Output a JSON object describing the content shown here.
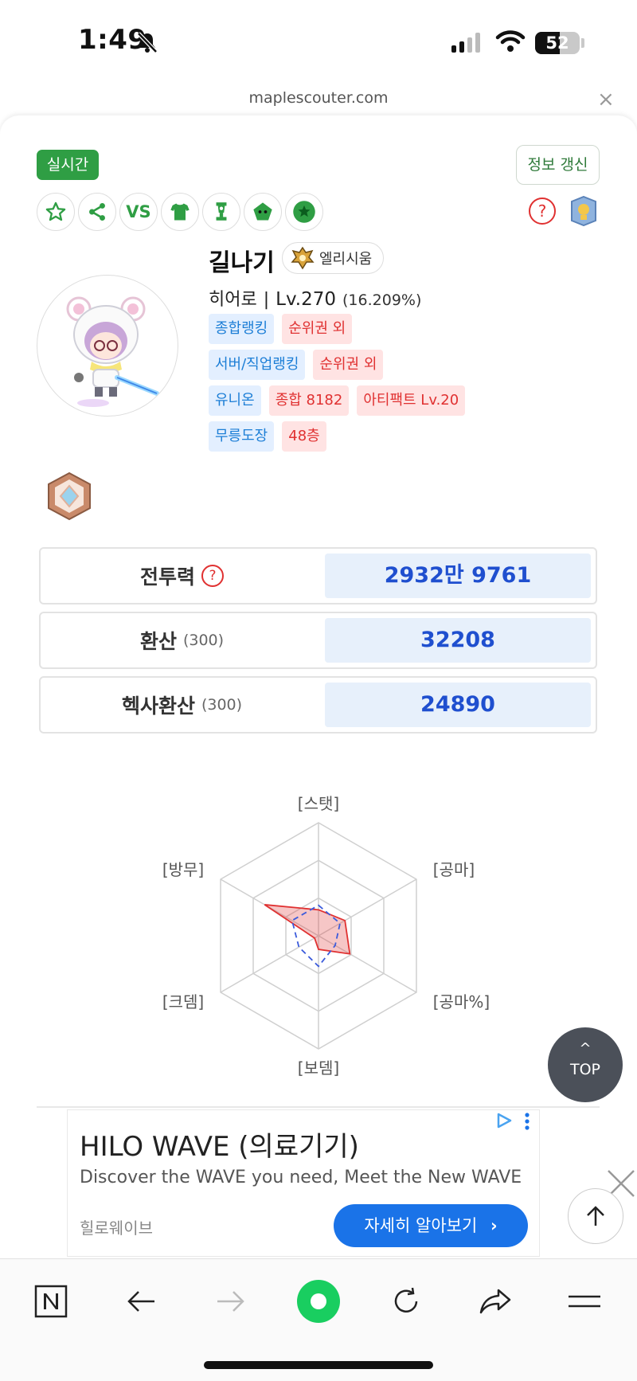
{
  "status_bar": {
    "time": "1:49",
    "battery": "52"
  },
  "browser": {
    "url": "maplescouter.com",
    "close": "×"
  },
  "header": {
    "live_label": "실시간",
    "refresh_label": "정보 갱신",
    "vs_label": "VS",
    "help": "?"
  },
  "character": {
    "name": "길나기",
    "server": "엘리시움",
    "class": "히어로",
    "separator": "|",
    "level": "Lv.270",
    "exp": "(16.209%)"
  },
  "tags": {
    "overall_rank_label": "종합랭킹",
    "overall_rank_value": "순위권 외",
    "server_rank_label": "서버/직업랭킹",
    "server_rank_value": "순위권 외",
    "union_label": "유니온",
    "union_total": "종합 8182",
    "union_artifact": "아티팩트 Lv.20",
    "dojang_label": "무릉도장",
    "dojang_value": "48층"
  },
  "stats": {
    "combat_label": "전투력",
    "combat_help": "?",
    "combat_value": "2932만 9761",
    "convert_label": "환산",
    "convert_sub": "(300)",
    "convert_value": "32208",
    "hexa_label": "헥사환산",
    "hexa_sub": "(300)",
    "hexa_value": "24890"
  },
  "chart_data": {
    "type": "radar",
    "axes": [
      "[스탯]",
      "[공마]",
      "[공마%]",
      "[보뎀]",
      "[크뎀]",
      "[방무]"
    ],
    "series": [
      {
        "values": [
          0.23,
          0.27,
          0.32,
          0.12,
          0.04,
          0.55
        ],
        "color": "#e03131"
      },
      {
        "values": [
          0.27,
          0.22,
          0.17,
          0.27,
          0.2,
          0.27
        ],
        "color": "#3b5bdb"
      }
    ],
    "range": [
      0,
      1
    ]
  },
  "top_button": {
    "arrow": "^",
    "label": "TOP"
  },
  "ad": {
    "title": "HILO WAVE (의료기기)",
    "description": "Discover the WAVE you need, Meet the New WAVE",
    "brand": "힐로웨이브",
    "cta": "자세히 알아보기"
  }
}
